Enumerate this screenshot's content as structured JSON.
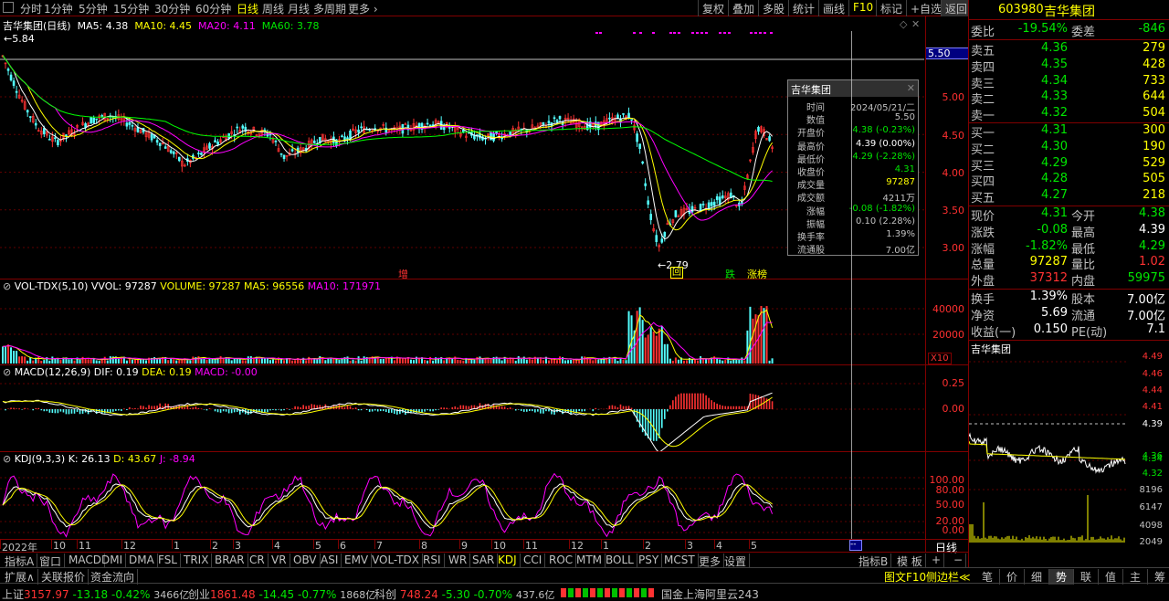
{
  "toolbar": {
    "periods": [
      "分时",
      "1分钟",
      "5分钟",
      "15分钟",
      "30分钟",
      "60分钟",
      "日线",
      "周线",
      "月线",
      "多周期",
      "更多"
    ],
    "active_period": "日线",
    "tools": [
      "复权",
      "叠加",
      "多股",
      "统计",
      "画线",
      "F10",
      "标记",
      "+自选",
      "返回"
    ]
  },
  "main_chart": {
    "title": "吉华集团(日线)",
    "ma5": "MA5: 4.38",
    "ma10": "MA10: 4.45",
    "ma20": "MA20: 4.11",
    "ma60": "MA60: 3.78",
    "high_mark": "5.84",
    "low_mark": "2.79",
    "crosshair_price": "5.50",
    "y_ticks": [
      "5.00",
      "4.50",
      "4.00",
      "3.50",
      "3.00"
    ],
    "markers": [
      "增",
      "回",
      "跌",
      "涨榜"
    ],
    "colors": {
      "ma5": "#ffffff",
      "ma10": "#ffff00",
      "ma20": "#ff00ff",
      "ma60": "#00ff00",
      "up": "#ff3232",
      "down": "#54ffff"
    }
  },
  "info_box": {
    "title": "吉华集团",
    "rows": [
      {
        "k": "时间",
        "v": "2024/05/21/二",
        "c": "gray"
      },
      {
        "k": "数值",
        "v": "5.50",
        "c": "gray"
      },
      {
        "k": "开盘价",
        "v": "4.38 (-0.23%)",
        "c": "green"
      },
      {
        "k": "最高价",
        "v": "4.39 (0.00%)",
        "c": "white"
      },
      {
        "k": "最低价",
        "v": "4.29 (-2.28%)",
        "c": "green"
      },
      {
        "k": "收盘价",
        "v": "4.31",
        "c": "green"
      },
      {
        "k": "成交量",
        "v": "97287",
        "c": "yellow"
      },
      {
        "k": "成交额",
        "v": "4211万",
        "c": "gray"
      },
      {
        "k": "涨幅",
        "v": "-0.08 (-1.82%)",
        "c": "green"
      },
      {
        "k": "振幅",
        "v": "0.10 (2.28%)",
        "c": "gray"
      },
      {
        "k": "换手率",
        "v": "1.39%",
        "c": "gray"
      },
      {
        "k": "流通股",
        "v": "7.00亿",
        "c": "gray"
      }
    ]
  },
  "vol_panel": {
    "title": "VOL-TDX(5,10)",
    "vvol": "VVOL: 97287",
    "volume": "VOLUME: 97287",
    "ma5": "MA5: 96556",
    "ma10": "MA10: 171971",
    "y_ticks": [
      "40000",
      "20000"
    ],
    "unit": "X10"
  },
  "macd_panel": {
    "title": "MACD(12,26,9)",
    "dif": "DIF: 0.19",
    "dea": "DEA: 0.19",
    "macd": "MACD: -0.00",
    "y_ticks": [
      "0.25",
      "0.00"
    ]
  },
  "kdj_panel": {
    "title": "KDJ(9,3,3)",
    "k": "K: 26.13",
    "d": "D: 43.67",
    "j": "J: -8.94",
    "y_ticks": [
      "100.00",
      "80.00",
      "50.00",
      "20.00",
      "0.00"
    ]
  },
  "x_axis": {
    "labels": [
      "2022年",
      "10",
      "11",
      "12",
      "1",
      "2",
      "3",
      "4",
      "5",
      "6",
      "7",
      "8",
      "9",
      "10",
      "11",
      "12",
      "1",
      "2",
      "3",
      "4",
      "5"
    ],
    "period_label": "日线"
  },
  "right_pane": {
    "code": "603980",
    "name": "吉华集团",
    "weibi_label": "委比",
    "weibi": "-19.54%",
    "weicha_label": "委差",
    "weicha": "-846",
    "asks": [
      {
        "l": "卖五",
        "p": "4.36",
        "v": "279"
      },
      {
        "l": "卖四",
        "p": "4.35",
        "v": "428"
      },
      {
        "l": "卖三",
        "p": "4.34",
        "v": "733"
      },
      {
        "l": "卖二",
        "p": "4.33",
        "v": "644"
      },
      {
        "l": "卖一",
        "p": "4.32",
        "v": "504"
      }
    ],
    "bids": [
      {
        "l": "买一",
        "p": "4.31",
        "v": "300"
      },
      {
        "l": "买二",
        "p": "4.30",
        "v": "190"
      },
      {
        "l": "买三",
        "p": "4.29",
        "v": "529"
      },
      {
        "l": "买四",
        "p": "4.28",
        "v": "505"
      },
      {
        "l": "买五",
        "p": "4.27",
        "v": "218"
      }
    ],
    "quotes": [
      {
        "l1": "现价",
        "v1": "4.31",
        "c1": "green",
        "l2": "今开",
        "v2": "4.38",
        "c2": "green"
      },
      {
        "l1": "涨跌",
        "v1": "-0.08",
        "c1": "green",
        "l2": "最高",
        "v2": "4.39",
        "c2": "white"
      },
      {
        "l1": "涨幅",
        "v1": "-1.82%",
        "c1": "green",
        "l2": "最低",
        "v2": "4.29",
        "c2": "green"
      },
      {
        "l1": "总量",
        "v1": "97287",
        "c1": "yellow",
        "l2": "量比",
        "v2": "1.02",
        "c2": "red"
      },
      {
        "l1": "外盘",
        "v1": "37312",
        "c1": "red",
        "l2": "内盘",
        "v2": "59975",
        "c2": "green"
      }
    ],
    "fund": [
      {
        "l1": "换手",
        "v1": "1.39%",
        "l2": "股本",
        "v2": "7.00亿"
      },
      {
        "l1": "净资",
        "v1": "5.69",
        "l2": "流通",
        "v2": "7.00亿"
      },
      {
        "l1": "收益(一)",
        "v1": "0.150",
        "l2": "PE(动)",
        "v2": "7.1"
      }
    ],
    "mini_title": "吉华集团",
    "mini_prices": [
      "4.49",
      "4.46",
      "4.44",
      "4.41",
      "4.39",
      "4.36",
      "4.34",
      "4.32"
    ],
    "mini_vols": [
      "8196",
      "6147",
      "4098",
      "2049"
    ]
  },
  "indicator_tabs": [
    "指标A",
    "窗口",
    "MACD",
    "DMI",
    "DMA",
    "FSL",
    "TRIX",
    "BRAR",
    "CR",
    "VR",
    "OBV",
    "ASI",
    "EMV",
    "VOL-TDX",
    "RSI",
    "WR",
    "SAR",
    "KDJ",
    "CCI",
    "ROC",
    "MTM",
    "BOLL",
    "PSY",
    "MCST",
    "更多",
    "设置"
  ],
  "active_indicator": "KDJ",
  "tab_extra": [
    "指标B",
    "模 板",
    "+",
    "−"
  ],
  "row2_tabs": [
    "扩展∧",
    "关联报价",
    "资金流向"
  ],
  "row2_right": [
    "图文F10",
    "侧边栏≪"
  ],
  "side_tabs": [
    "笔",
    "价",
    "细",
    "势",
    "联",
    "值",
    "主",
    "筹"
  ],
  "active_side_tab": "势",
  "status": {
    "sh_label": "上证",
    "sh_val": "3157.97",
    "sh_chg": "-13.18",
    "sh_pct": "-0.42%",
    "sh_amt": "3466亿",
    "cy_label": "创业",
    "cy_val": "1861.48",
    "cy_chg": "-14.45",
    "cy_pct": "-0.77%",
    "cy_amt": "1868亿",
    "kc_label": "科创",
    "kc_val": "748.24",
    "kc_chg": "-5.30",
    "kc_pct": "-0.70%",
    "kc_amt": "437.6亿",
    "server": "国金上海阿里云243"
  }
}
